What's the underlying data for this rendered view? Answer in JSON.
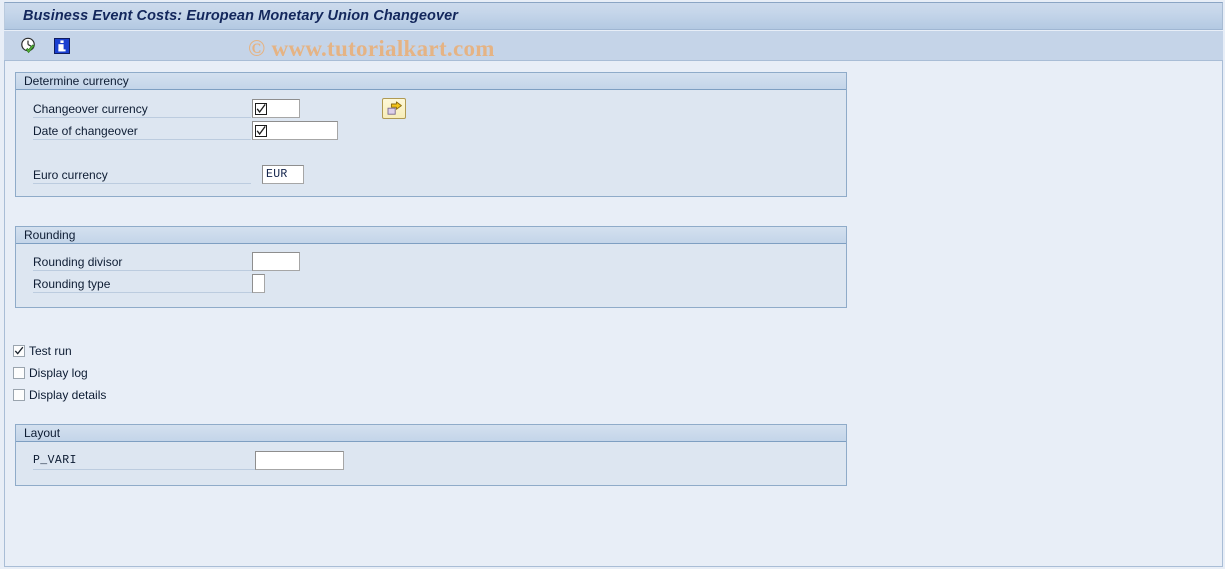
{
  "window": {
    "title": "Business Event Costs: European Monetary Union Changeover"
  },
  "toolbar": {
    "buttons": [
      {
        "name": "execute-clock-icon",
        "tooltip": "Execute"
      },
      {
        "name": "information-icon",
        "tooltip": "Information"
      }
    ]
  },
  "watermark": {
    "text": "© www.tutorialkart.com"
  },
  "groups": {
    "determine_currency": {
      "title": "Determine currency",
      "fields": {
        "changeover_currency": {
          "label": "Changeover currency",
          "value": "",
          "placeholder": ""
        },
        "date_of_changeover": {
          "label": "Date of changeover",
          "value": "",
          "placeholder": ""
        },
        "euro_currency": {
          "label": "Euro currency",
          "value": "EUR",
          "placeholder": ""
        }
      },
      "multi_select_button": {
        "label": "",
        "tooltip": "Multiple selection"
      }
    },
    "rounding": {
      "title": "Rounding",
      "fields": {
        "rounding_divisor": {
          "label": "Rounding divisor",
          "value": "",
          "placeholder": ""
        },
        "rounding_type": {
          "label": "Rounding type",
          "value": "",
          "placeholder": ""
        }
      }
    },
    "layout": {
      "title": "Layout",
      "fields": {
        "p_vari": {
          "label": "P_VARI",
          "value": "",
          "placeholder": ""
        }
      }
    }
  },
  "options": [
    {
      "label": "Test run",
      "checked": true
    },
    {
      "label": "Display log",
      "checked": false
    },
    {
      "label": "Display details",
      "checked": false
    }
  ],
  "colors": {
    "page_background": "#e8eef7",
    "panel_background": "#dde6f1",
    "panel_border": "#8fabc9",
    "title_text": "#13275c",
    "watermark": "#e5b384",
    "button_yellow": "#f7edb9",
    "info_blue": "#1a3fd0"
  }
}
